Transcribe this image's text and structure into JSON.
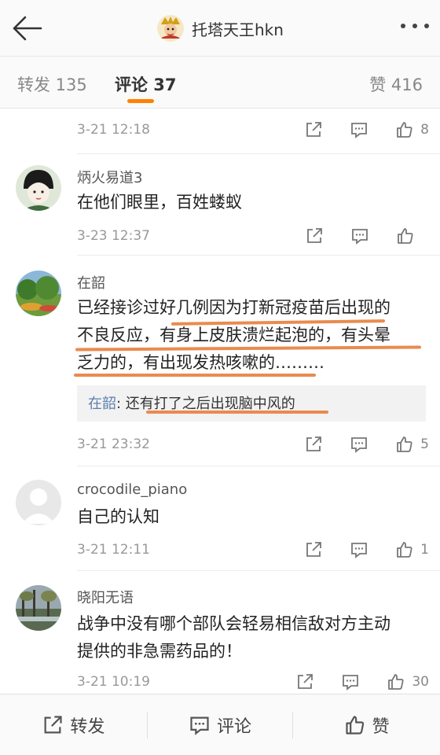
{
  "header": {
    "title": "托塔天王hkn"
  },
  "tabs": [
    {
      "label": "转发 135"
    },
    {
      "label": "评论 37"
    },
    {
      "label": "赞 416"
    }
  ],
  "comments": [
    {
      "date": "3-21 12:18",
      "likes": "8"
    },
    {
      "name": "炳火易道3",
      "text": "在他们眼里，百姓蝼蚁",
      "date": "3-23 12:37",
      "likes": ""
    },
    {
      "name": "在韶",
      "text_lines": [
        "已经接诊过好几例因为打新冠疫苗后出现的",
        "不良反应，有身上皮肤溃烂起泡的，有头晕",
        "乏力的，有出现发热咳嗽的………"
      ],
      "reply_name": "在韶",
      "reply_text": ": 还有打了之后出现脑中风的",
      "date": "3-21 23:32",
      "likes": "5"
    },
    {
      "name": "crocodile_piano",
      "text": "自己的认知",
      "date": "3-21 12:11",
      "likes": "1"
    },
    {
      "name": "晓阳无语",
      "text_lines": [
        "战争中没有哪个部队会轻易相信敌对方主动",
        "提供的非急需药品的！"
      ],
      "date": "3-21 10:19",
      "likes": "30"
    }
  ],
  "bottom": {
    "repost": "转发",
    "comment": "评论",
    "like": "赞"
  },
  "colors": {
    "accent": "#ff8200",
    "highlight": "#e98b4e",
    "reply_name": "#5b7fad"
  }
}
